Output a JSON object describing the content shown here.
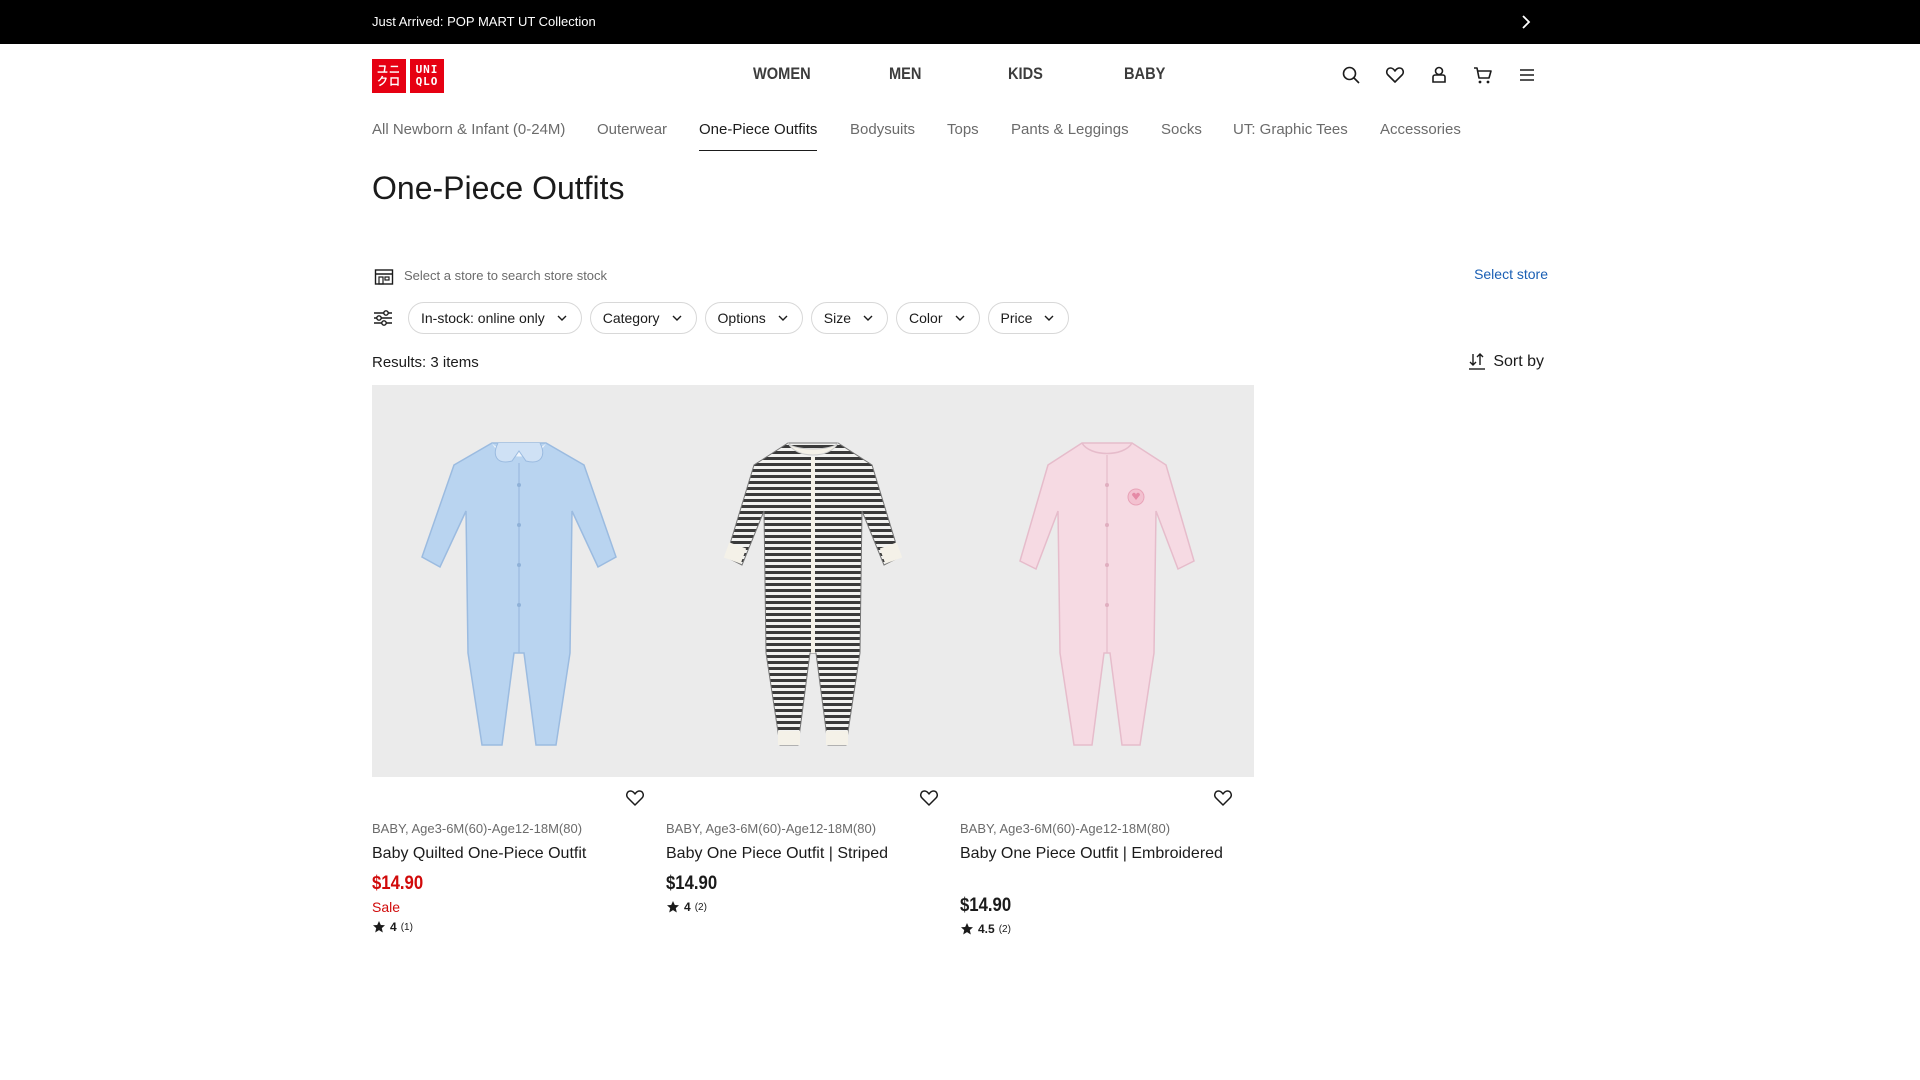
{
  "announcement": {
    "text": "Just Arrived: POP MART UT Collection"
  },
  "logo": {
    "line1": "ユニ",
    "line2": "クロ",
    "line3": "UNI",
    "line4": "QLO"
  },
  "main_nav": [
    "WOMEN",
    "MEN",
    "KIDS",
    "BABY"
  ],
  "sub_nav": [
    {
      "label": "All Newborn & Infant (0-24M)"
    },
    {
      "label": "Outerwear"
    },
    {
      "label": "One-Piece Outfits",
      "active": true
    },
    {
      "label": "Bodysuits"
    },
    {
      "label": "Tops"
    },
    {
      "label": "Pants & Leggings"
    },
    {
      "label": "Socks"
    },
    {
      "label": "UT: Graphic Tees"
    },
    {
      "label": "Accessories"
    }
  ],
  "page_title": "One-Piece Outfits",
  "store": {
    "prompt": "Select a store to search store stock",
    "link": "Select store"
  },
  "filters": [
    "In-stock: online only",
    "Category",
    "Options",
    "Size",
    "Color",
    "Price"
  ],
  "results": {
    "label": "Results: 3 items"
  },
  "sort": {
    "label": "Sort by"
  },
  "products": [
    {
      "meta": "BABY, Age3-6M(60)-Age12-18M(80)",
      "name": "Baby Quilted One-Piece Outfit",
      "price": "$14.90",
      "sale": "Sale",
      "rating": "4",
      "count": "(1)",
      "color": "#b9d4f0"
    },
    {
      "meta": "BABY, Age3-6M(60)-Age12-18M(80)",
      "name": "Baby One Piece Outfit | Striped",
      "price": "$14.90",
      "sale": "",
      "rating": "4",
      "count": "(2)",
      "color": "#9a9a9a"
    },
    {
      "meta": "BABY, Age3-6M(60)-Age12-18M(80)",
      "name": "Baby One Piece Outfit | Embroidered",
      "price": "$14.90",
      "sale": "",
      "rating": "4.5",
      "count": "(2)",
      "color": "#f4d5de"
    }
  ],
  "colors": {
    "brand_red": "#e60012",
    "sale_red": "#d10a0a",
    "link_blue": "#1a5fb4"
  },
  "icons": [
    "chevron-right-icon",
    "search-icon",
    "heart-icon",
    "user-icon",
    "cart-icon",
    "menu-icon",
    "store-icon",
    "filter-icon",
    "chevron-down-icon",
    "sort-icon",
    "star-icon"
  ]
}
